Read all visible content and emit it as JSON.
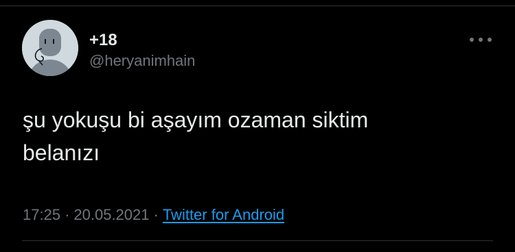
{
  "tweet": {
    "display_name": "+18",
    "handle": "@heryanimhain",
    "text": "şu yokuşu bi aşayım ozaman siktim\nbelanızı",
    "time": "17:25",
    "separator": "·",
    "date": "20.05.2021",
    "source": "Twitter for Android",
    "avatar_icon": "default-profile-icon",
    "more_icon": "more-dots-icon"
  },
  "colors": {
    "background": "#000000",
    "text_primary": "#e7e9ea",
    "text_secondary": "#71767b",
    "link": "#1d9bf0",
    "divider": "#2f3336",
    "avatar_bg": "#cfd9de",
    "avatar_figure": "#7c8791"
  }
}
